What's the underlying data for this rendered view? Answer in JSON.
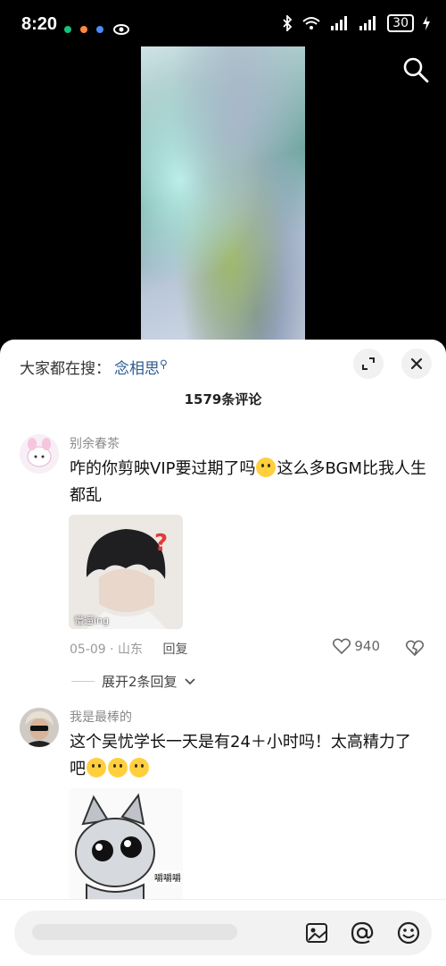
{
  "status_bar": {
    "time": "8:20",
    "battery": "30",
    "app_dot_colors": [
      "#16c27a",
      "#ff8a3d",
      "#4a8cff"
    ]
  },
  "hot_search": {
    "prefix": "大家都在搜：",
    "keyword": "念相思"
  },
  "comment_count": "1579条评论",
  "comments": [
    {
      "username": "别余春茶",
      "text": "咋的你剪映VIP要过期了吗",
      "text_after_emoji": "这么多BGM比我人生都乱",
      "image_caption": "懵逼ing",
      "date": "05-09",
      "location": "山东",
      "reply_label": "回复",
      "likes": "940",
      "expand_label": "展开2条回复"
    },
    {
      "username": "我是最棒的",
      "text": "这个吴忧学长一天是有24＋小时吗！太高精力了吧",
      "image_caption": "嚼嚼嚼"
    }
  ],
  "icons": {
    "search": "search-icon",
    "expand": "fullscreen-icon",
    "close": "close-icon",
    "like": "heart-icon",
    "dislike": "broken-heart-icon",
    "image": "image-icon",
    "at": "at-icon",
    "emoji": "emoji-icon"
  }
}
